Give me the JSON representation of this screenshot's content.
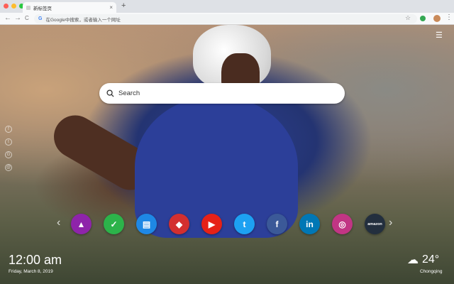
{
  "browser": {
    "tab_title": "新标签页",
    "tab_close": "×",
    "new_tab": "+",
    "back": "←",
    "forward": "→",
    "reload": "C",
    "omnibox_placeholder": "在Google中搜索，或者输入一个网址",
    "omnibox_g": "G",
    "star": "☆",
    "menu": "⋮"
  },
  "page": {
    "menu_icon": "☰",
    "search_placeholder": "Search",
    "clock": "12:00 am",
    "date": "Friday, March 8, 2019",
    "temperature": "24°",
    "city": "Chongqing",
    "prev_arrow": "‹",
    "next_arrow": "›"
  },
  "side_social": [
    {
      "glyph": "f",
      "name": "side-facebook-icon"
    },
    {
      "glyph": "t",
      "name": "side-twitter-icon"
    },
    {
      "glyph": "G",
      "name": "side-google-icon"
    },
    {
      "glyph": "@",
      "name": "side-share-icon"
    }
  ],
  "dock": [
    {
      "name": "photo-editor",
      "glyph": "▲",
      "color": "#8e24aa"
    },
    {
      "name": "checkmark",
      "glyph": "✓",
      "color": "#2cb34a"
    },
    {
      "name": "news",
      "glyph": "▤",
      "color": "#1e88e5"
    },
    {
      "name": "game",
      "glyph": "◆",
      "color": "#d32f2f"
    },
    {
      "name": "youtube",
      "glyph": "▶",
      "color": "#e62117"
    },
    {
      "name": "twitter",
      "glyph": "t",
      "color": "#1da1f2"
    },
    {
      "name": "facebook",
      "glyph": "f",
      "color": "#3b5998"
    },
    {
      "name": "linkedin",
      "glyph": "in",
      "color": "#0077b5"
    },
    {
      "name": "instagram",
      "glyph": "◎",
      "color": "#c13584"
    },
    {
      "name": "amazon",
      "glyph": "amazon",
      "color": "#232f3e"
    }
  ]
}
